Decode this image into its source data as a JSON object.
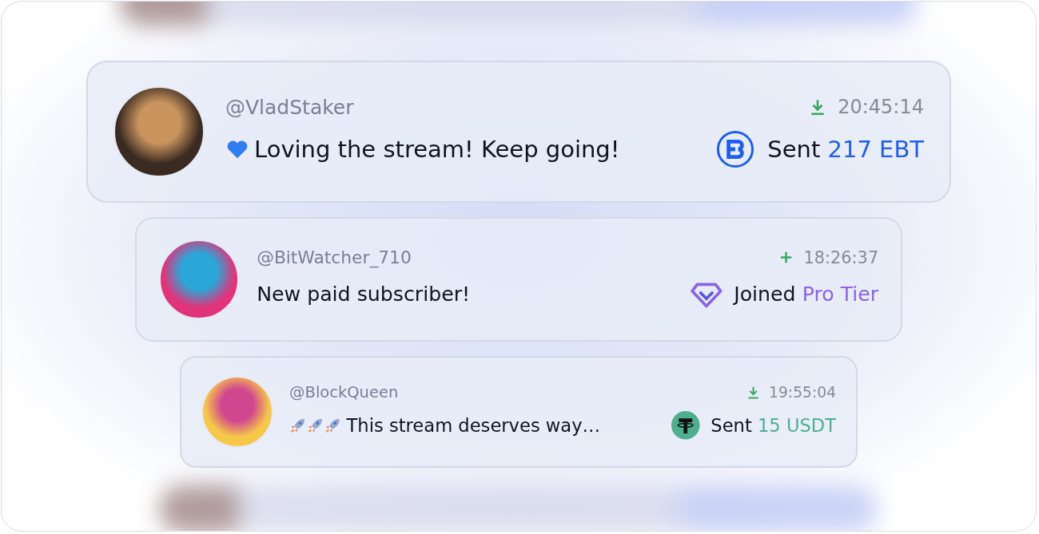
{
  "messages": [
    {
      "username": "@VladStaker",
      "status_icon": {
        "kind": "download"
      },
      "time": "20:45:14",
      "emoji": {
        "kind": "heart"
      },
      "text": "Loving the stream! Keep going!",
      "token_icon": {
        "kind": "ebt"
      },
      "action": "Sent",
      "amount": "217 EBT",
      "color": "#1f5cf0"
    },
    {
      "username": "@BitWatcher_710",
      "status_icon": {
        "kind": "plus"
      },
      "time": "18:26:37",
      "text": "New paid subscriber!",
      "token_icon": {
        "kind": "diamond"
      },
      "action": "Joined",
      "amount": "Pro Tier",
      "color": "#8a63e6"
    },
    {
      "username": "@BlockQueen",
      "status_icon": {
        "kind": "download"
      },
      "time": "19:55:04",
      "emoji": {
        "kind": "rockets"
      },
      "text": "This stream deserves way…",
      "token_icon": {
        "kind": "tether"
      },
      "action": "Sent",
      "amount": "15 USDT",
      "color": "#4fae8e"
    }
  ]
}
